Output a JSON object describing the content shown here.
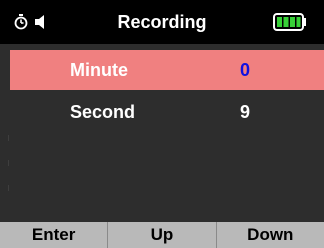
{
  "header": {
    "title": "Recording",
    "icons": [
      "timer-icon",
      "speaker-icon",
      "battery-icon"
    ],
    "battery_color": "#37d037"
  },
  "rows": [
    {
      "label": "Minute",
      "value": "0",
      "selected": true
    },
    {
      "label": "Second",
      "value": "9",
      "selected": false
    }
  ],
  "footer": {
    "enter_label": "Enter",
    "up_label": "Up",
    "down_label": "Down"
  },
  "colors": {
    "selected_row_bg": "#f08080",
    "selected_value": "#1010e0",
    "body_bg": "#2d2d2d",
    "button_bg": "#b9b9b9"
  }
}
